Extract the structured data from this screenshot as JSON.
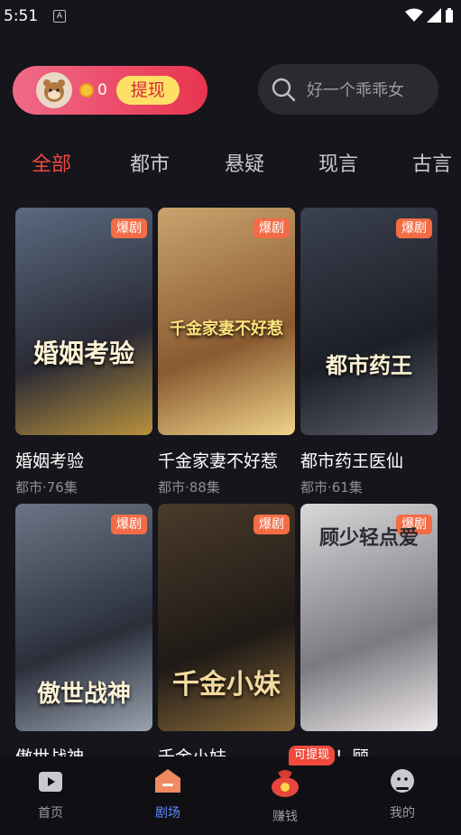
{
  "status_bar": {
    "time": "5:51",
    "notif_icon": "A"
  },
  "header": {
    "coin_count": "0",
    "withdraw_label": "提现",
    "search_placeholder": "好一个乖乖女"
  },
  "tabs": [
    {
      "label": "全部",
      "active": true
    },
    {
      "label": "都市",
      "active": false
    },
    {
      "label": "悬疑",
      "active": false
    },
    {
      "label": "现言",
      "active": false
    },
    {
      "label": "古言",
      "active": false
    }
  ],
  "dramas": [
    {
      "title": "婚姻考验",
      "meta": "都市·76集",
      "badge": "爆剧",
      "poster_text": "婚姻考验",
      "colors": [
        "#5a6a80",
        "#2a2a35",
        "#b8913d"
      ]
    },
    {
      "title": "千金家妻不好惹",
      "meta": "都市·88集",
      "badge": "爆剧",
      "poster_text": "千金家妻不好惹",
      "colors": [
        "#c8a36d",
        "#8a5a30",
        "#f0d38a"
      ]
    },
    {
      "title": "都市药王医仙",
      "meta": "都市·61集",
      "badge": "爆剧",
      "poster_text": "都市药王",
      "colors": [
        "#3b4150",
        "#1c1f26",
        "#5a5e6a"
      ]
    },
    {
      "title": "傲世战神",
      "meta": "",
      "badge": "爆剧",
      "poster_text": "傲世战神",
      "colors": [
        "#6a7585",
        "#2a2f3a",
        "#9aa3b0"
      ]
    },
    {
      "title": "千金小妹",
      "meta": "",
      "badge": "爆剧",
      "poster_text": "千金小妹",
      "colors": [
        "#4a3a2a",
        "#1f1a16",
        "#8a6a3a"
      ]
    },
    {
      "title": "惊喜！顾",
      "meta": "",
      "badge": "爆剧",
      "poster_text": "顾少轻点爱",
      "colors": [
        "#d8d8da",
        "#7a7a80",
        "#efe9ea"
      ]
    }
  ],
  "bottom_nav": [
    {
      "label": "首页",
      "icon": "home-video-icon",
      "active": false
    },
    {
      "label": "剧场",
      "icon": "theater-icon",
      "active": true
    },
    {
      "label": "赚钱",
      "icon": "money-bag-icon",
      "active": false,
      "tag": "可提现"
    },
    {
      "label": "我的",
      "icon": "profile-icon",
      "active": false
    }
  ]
}
